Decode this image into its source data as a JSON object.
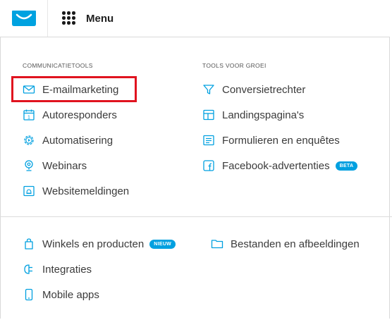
{
  "topbar": {
    "menu_label": "Menu",
    "brand_color": "#00a2e0"
  },
  "sections": {
    "communication": {
      "title": "COMMUNICATIETOOLS",
      "items": [
        {
          "label": "E-mailmarketing",
          "icon": "envelope-icon",
          "highlighted": true
        },
        {
          "label": "Autoresponders",
          "icon": "calendar-icon"
        },
        {
          "label": "Automatisering",
          "icon": "gear-play-icon"
        },
        {
          "label": "Webinars",
          "icon": "webcam-icon"
        },
        {
          "label": "Websitemeldingen",
          "icon": "bell-window-icon"
        }
      ]
    },
    "growth": {
      "title": "TOOLS VOOR GROEI",
      "items": [
        {
          "label": "Conversietrechter",
          "icon": "funnel-icon"
        },
        {
          "label": "Landingspagina's",
          "icon": "layout-icon"
        },
        {
          "label": "Formulieren en enquêtes",
          "icon": "form-icon"
        },
        {
          "label": "Facebook-advertenties",
          "icon": "facebook-icon",
          "badge": "BETA"
        }
      ]
    },
    "other": {
      "left": [
        {
          "label": "Winkels en producten",
          "icon": "shopping-bag-icon",
          "badge": "NIEUW"
        },
        {
          "label": "Integraties",
          "icon": "plug-icon"
        },
        {
          "label": "Mobile apps",
          "icon": "mobile-icon"
        }
      ],
      "right": [
        {
          "label": "Bestanden en afbeeldingen",
          "icon": "folder-icon"
        }
      ]
    }
  },
  "colors": {
    "accent": "#00a0e0",
    "highlight_border": "#e0131f"
  }
}
